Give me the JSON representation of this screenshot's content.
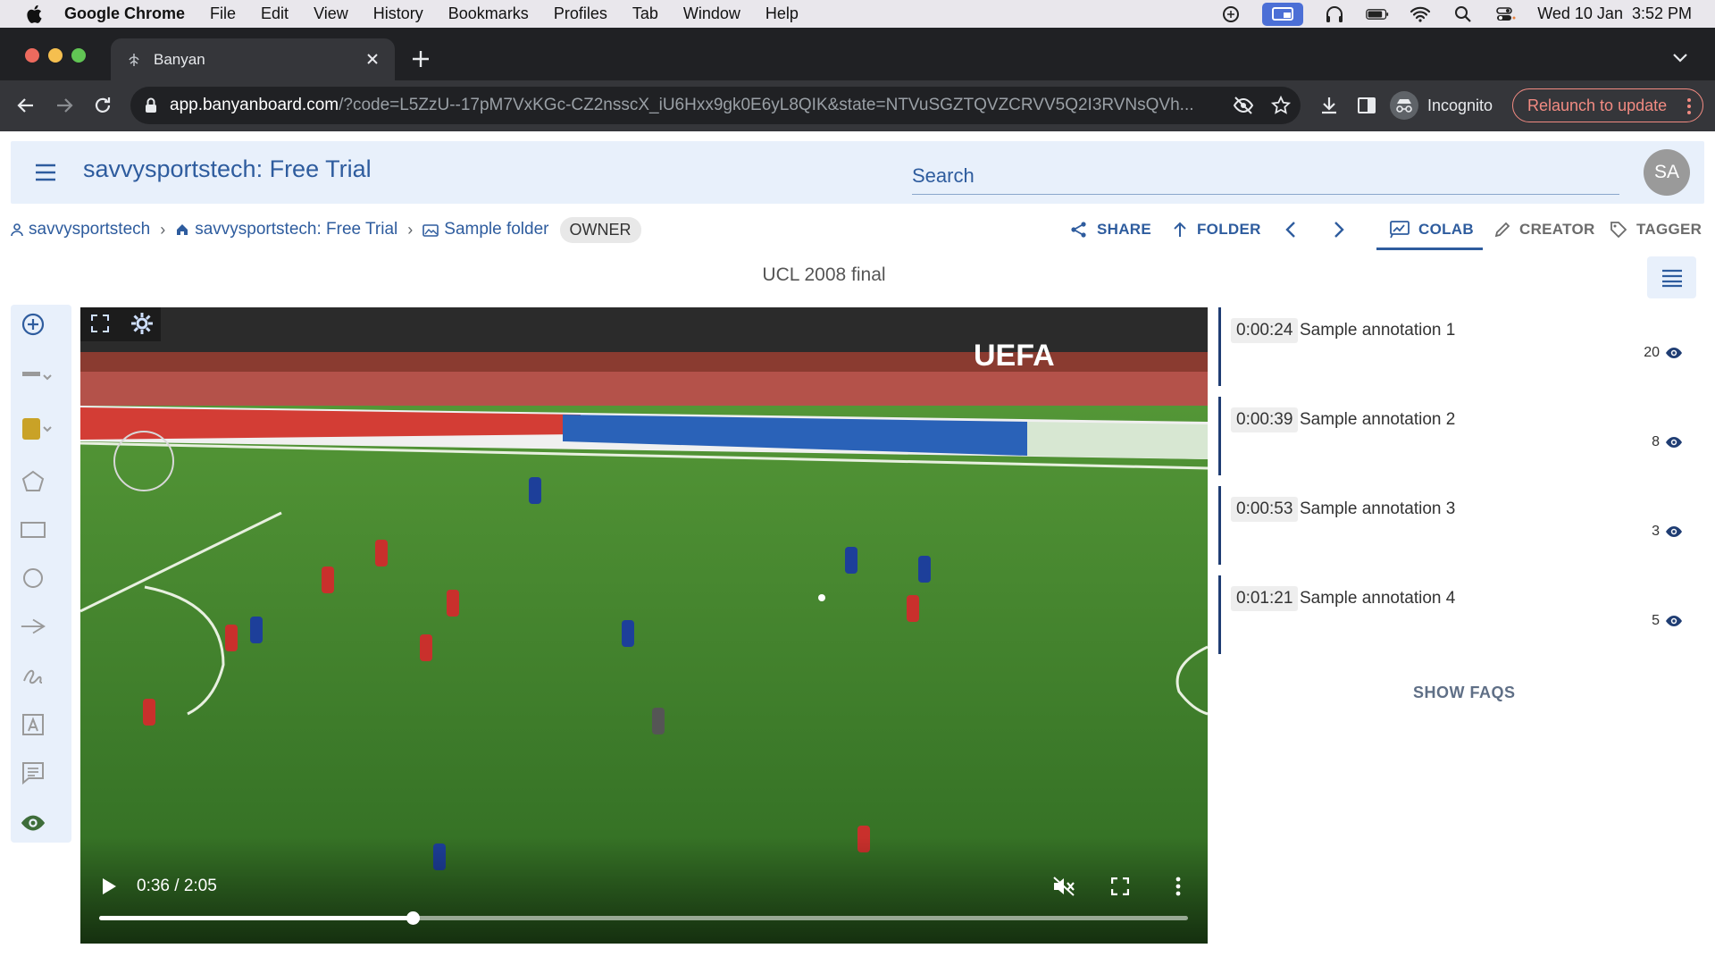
{
  "menubar": {
    "app_name": "Google Chrome",
    "items": [
      "File",
      "Edit",
      "View",
      "History",
      "Bookmarks",
      "Profiles",
      "Tab",
      "Window",
      "Help"
    ],
    "datetime": "Wed 10 Jan  3:52 PM"
  },
  "browser": {
    "tab_title": "Banyan",
    "url_host": "app.banyanboard.com",
    "url_path": "/?code=L5ZzU--17pM7VxKGc-CZ2nsscX_iU6Hxx9gk0E6yL8QIK&state=NTVuSGZTQVZCRVV5Q2I3RVNsQVh...",
    "profile_label": "Incognito",
    "relaunch_label": "Relaunch to update"
  },
  "header": {
    "title": "savvysportstech: Free Trial",
    "search_placeholder": "Search",
    "avatar_initials": "SA"
  },
  "breadcrumb": {
    "items": [
      "savvysportstech",
      "savvysportstech: Free Trial",
      "Sample folder"
    ],
    "role_badge": "OWNER"
  },
  "actions": {
    "share": "SHARE",
    "folder": "FOLDER",
    "colab": "COLAB",
    "creator": "CREATOR",
    "tagger": "TAGGER"
  },
  "video": {
    "title": "UCL 2008 final",
    "time_display": "0:36 / 2:05",
    "progress_fraction": 0.288,
    "overlay_logo": "UEFA"
  },
  "annotations": [
    {
      "time": "0:00:24",
      "label": "Sample annotation 1",
      "views": "20"
    },
    {
      "time": "0:00:39",
      "label": "Sample annotation 2",
      "views": "8"
    },
    {
      "time": "0:00:53",
      "label": "Sample annotation 3",
      "views": "3"
    },
    {
      "time": "0:01:21",
      "label": "Sample annotation 4",
      "views": "5"
    }
  ],
  "faqs_label": "SHOW FAQS",
  "colors": {
    "accent": "#2e5c9e",
    "header_bg": "#e8f0fb",
    "pitch": "#3f7a2c",
    "annotation_border": "#1f3d73",
    "color_swatch": "#c9a227"
  }
}
